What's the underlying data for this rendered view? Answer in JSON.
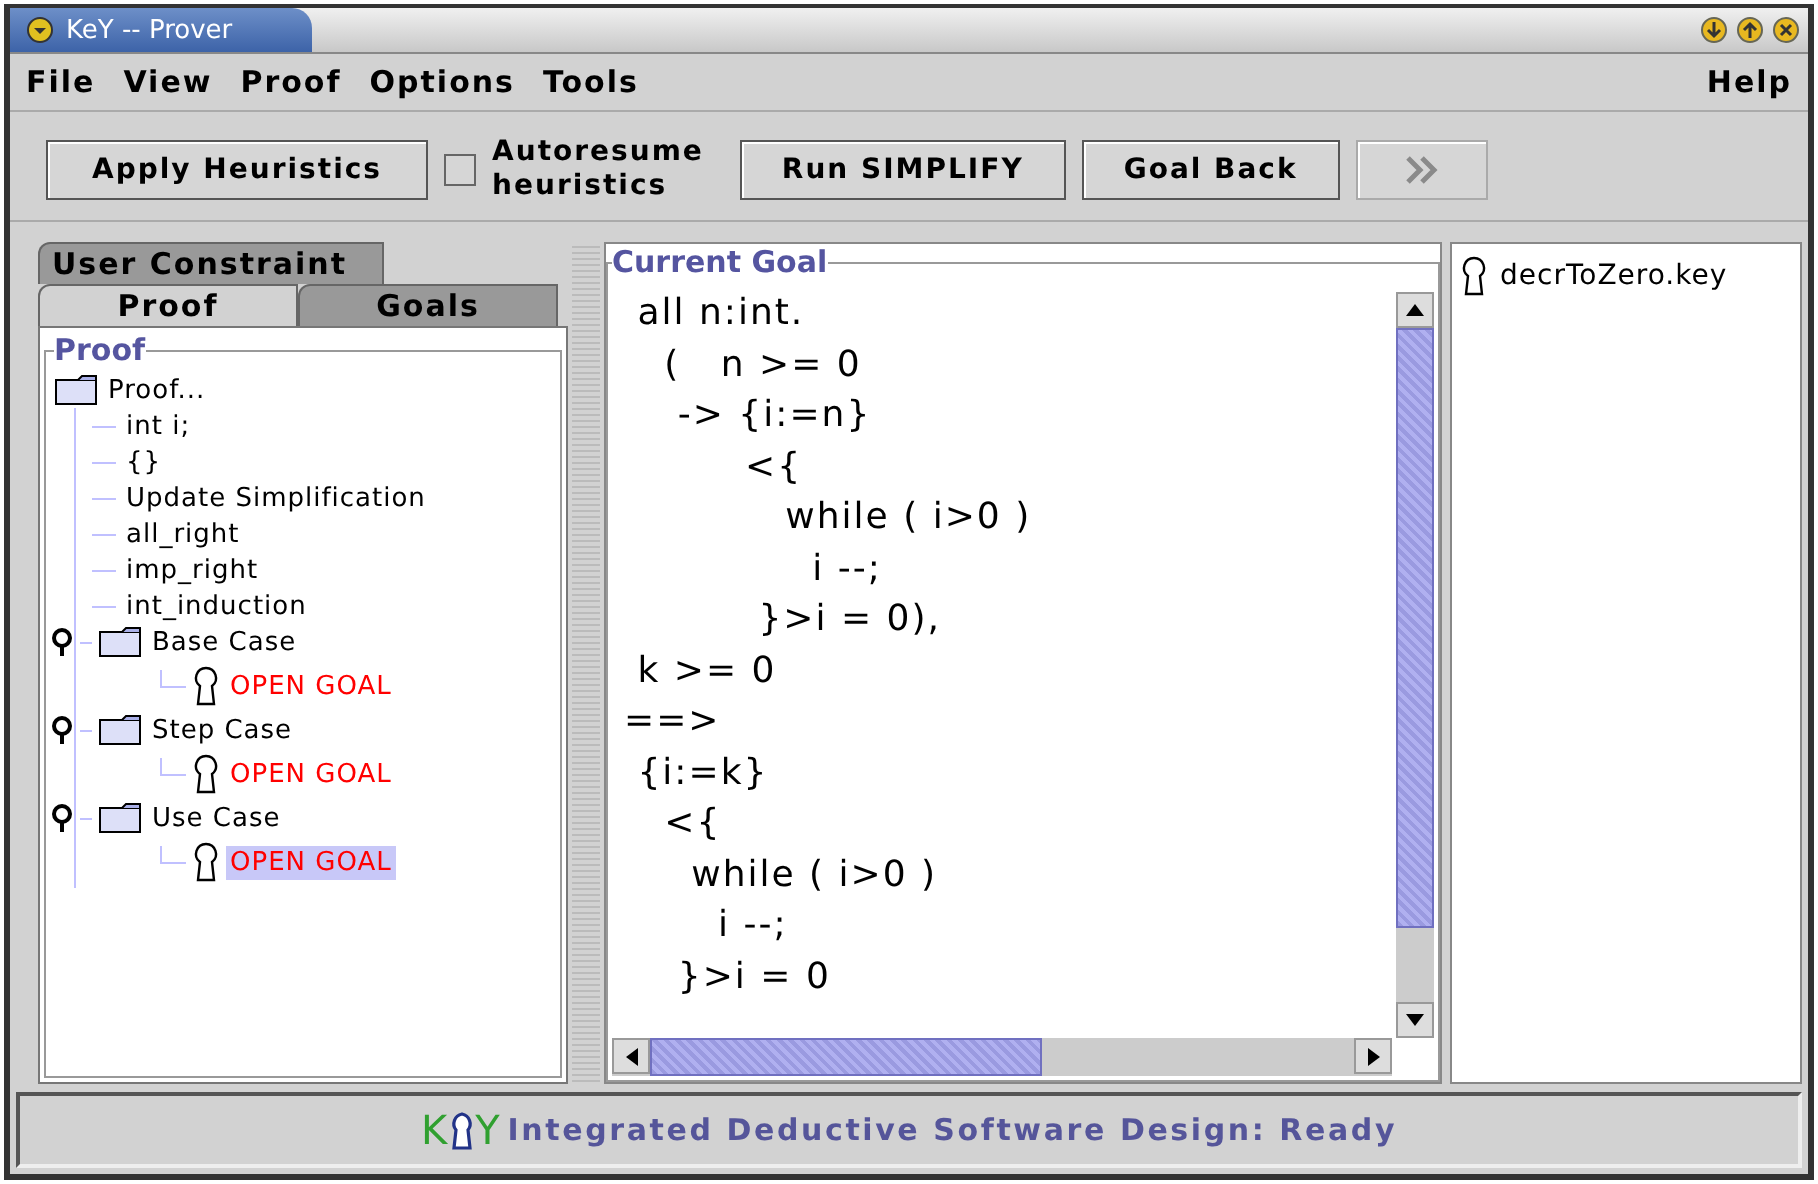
{
  "window": {
    "title": "KeY -- Prover"
  },
  "menu": {
    "left": [
      "File",
      "View",
      "Proof",
      "Options",
      "Tools"
    ],
    "right": [
      "Help"
    ]
  },
  "toolbar": {
    "apply_button": "Apply Heuristics",
    "autoresume": {
      "label_1": "Autoresume",
      "label_2": "heuristics",
      "checked": false
    },
    "simplify_button": "Run SIMPLIFY",
    "goal_back_button": "Goal Back",
    "forward_button": {
      "disabled": true
    }
  },
  "tabs_top": [
    {
      "label": "User Constraint",
      "selected": false
    }
  ],
  "tabs": [
    {
      "label": "Proof",
      "selected": true
    },
    {
      "label": "Goals",
      "selected": false
    }
  ],
  "proof_panel": {
    "title": "Proof",
    "tree": [
      {
        "kind": "folder",
        "label": "Proof...",
        "selected": false,
        "children": [
          {
            "kind": "leaf",
            "label": "int i;",
            "selected": false
          },
          {
            "kind": "leaf",
            "label": "{}",
            "selected": false
          },
          {
            "kind": "leaf",
            "label": "Update Simplification",
            "selected": false
          },
          {
            "kind": "leaf",
            "label": "all_right",
            "selected": false
          },
          {
            "kind": "leaf",
            "label": "imp_right",
            "selected": false
          },
          {
            "kind": "leaf",
            "label": "int_induction",
            "selected": false
          },
          {
            "kind": "folder",
            "label": "Base Case",
            "selected": false,
            "expanded": true,
            "children": [
              {
                "kind": "goal",
                "label": "OPEN GOAL",
                "selected": false
              }
            ]
          },
          {
            "kind": "folder",
            "label": "Step Case",
            "selected": false,
            "expanded": true,
            "children": [
              {
                "kind": "goal",
                "label": "OPEN GOAL",
                "selected": false
              }
            ]
          },
          {
            "kind": "folder",
            "label": "Use Case",
            "selected": false,
            "expanded": true,
            "children": [
              {
                "kind": "goal",
                "label": "OPEN GOAL",
                "selected": true
              }
            ]
          }
        ]
      }
    ]
  },
  "current_goal": {
    "title": "Current Goal",
    "text": " all n:int.\n   (   n >= 0\n    -> {i:=n}\n         <{\n            while ( i>0 )\n              i --;\n          }>i = 0),\n k >= 0\n==>\n {i:=k}\n   <{\n     while ( i>0 )\n       i --;\n    }>i = 0"
  },
  "files": [
    {
      "label": "decrToZero.key"
    }
  ],
  "status_bar": {
    "logo_left": "K",
    "logo_right": "Y",
    "text": "Integrated Deductive Software Design: Ready"
  }
}
